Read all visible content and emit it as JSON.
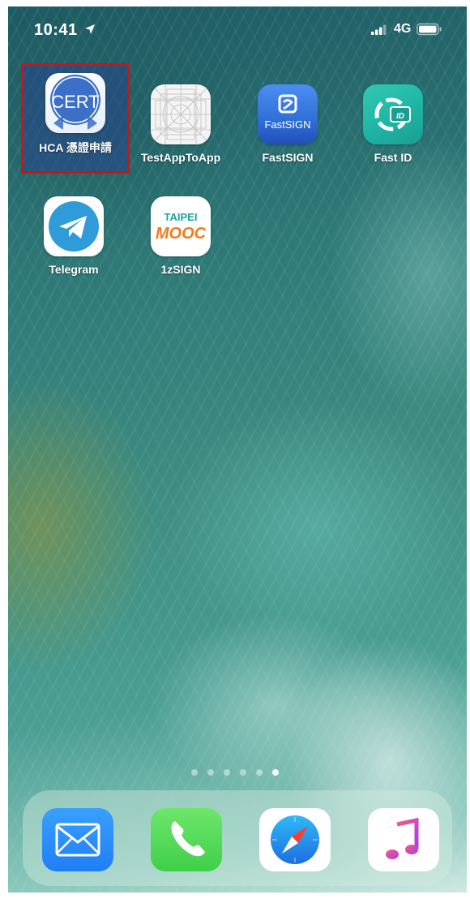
{
  "status_bar": {
    "time": "10:41",
    "network": "4G",
    "icons": [
      "location-arrow-icon",
      "cellular-signal-icon",
      "battery-icon"
    ]
  },
  "home_screen": {
    "apps": [
      {
        "label": "HCA 憑證申請",
        "icon": "cert-icon",
        "icon_text": "CERT",
        "highlighted": true
      },
      {
        "label": "TestAppToApp",
        "icon": "placeholder-grid-icon"
      },
      {
        "label": "FastSIGN",
        "icon": "fastsign-icon",
        "icon_text": "FastSIGN"
      },
      {
        "label": "Fast ID",
        "icon": "fast-id-icon",
        "icon_text": "ID"
      },
      {
        "label": "Telegram",
        "icon": "telegram-paper-plane-icon"
      },
      {
        "label": "1zSIGN",
        "icon": "taipei-mooc-icon",
        "icon_text_top": "TAIPEI",
        "icon_text_bottom": "MOOC"
      }
    ],
    "page_count": 6,
    "active_page": 5
  },
  "dock": {
    "apps": [
      {
        "name": "mail",
        "icon": "mail-envelope-icon",
        "color": "#1f7ef5"
      },
      {
        "name": "phone",
        "icon": "phone-handset-icon",
        "color": "#3fcf4a"
      },
      {
        "name": "safari",
        "icon": "safari-compass-icon",
        "color": "#1e90f0"
      },
      {
        "name": "music",
        "icon": "music-note-icon",
        "color": "#fa2d55"
      }
    ]
  },
  "colors": {
    "highlight_border": "#c8151b",
    "cert_blue": "#3b6fc8",
    "fastsign_blue": "#2f6fd8",
    "fastid_teal": "#1fb7a6",
    "telegram_blue": "#2f9bd9",
    "mooc_teal": "#1aa3a0",
    "mooc_orange": "#f07c1e"
  }
}
